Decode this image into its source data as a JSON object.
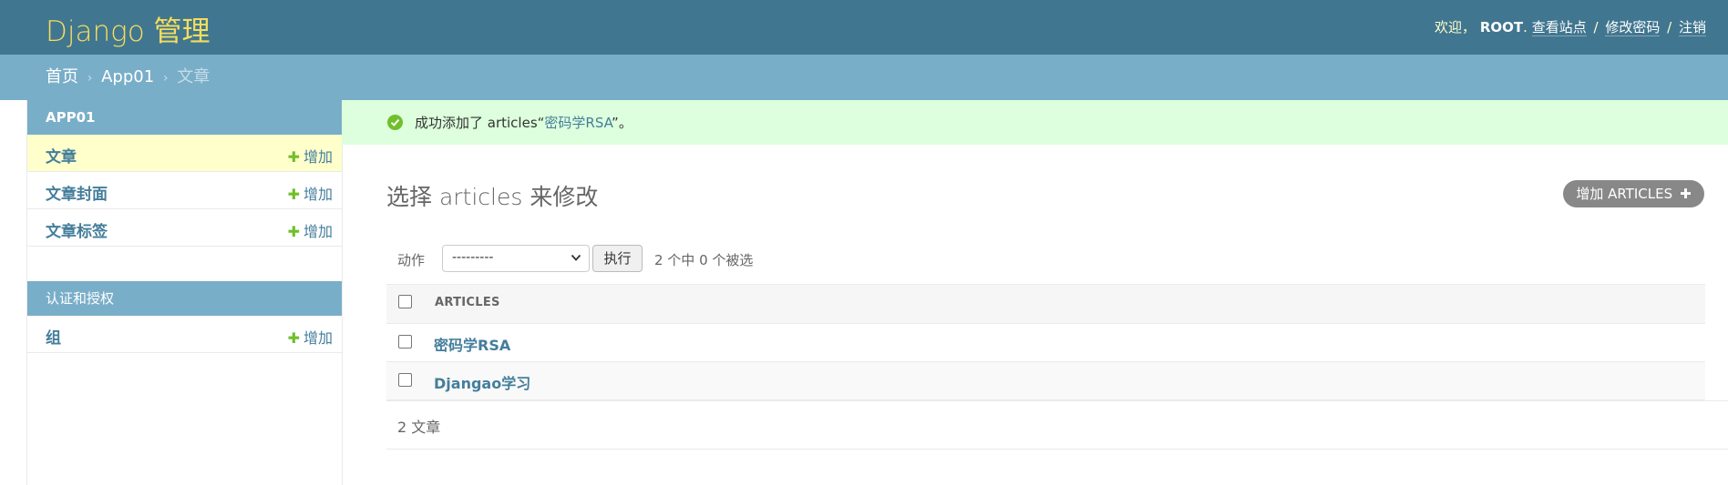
{
  "header": {
    "branding": "Django 管理",
    "welcome": "欢迎，",
    "username": "ROOT",
    "links": [
      {
        "label": "查看站点"
      },
      {
        "label": "修改密码"
      },
      {
        "label": "注销"
      }
    ]
  },
  "breadcrumbs": [
    {
      "label": "首页"
    },
    {
      "label": "App01"
    },
    {
      "label": "文章"
    }
  ],
  "sidebar": {
    "modules": [
      {
        "caption": "APP01",
        "items": [
          {
            "label": "文章",
            "add": "增加",
            "current": true
          },
          {
            "label": "文章封面",
            "add": "增加"
          },
          {
            "label": "文章标签",
            "add": "增加"
          }
        ]
      },
      {
        "caption": "认证和授权",
        "items": [
          {
            "label": "组",
            "add": "增加"
          }
        ]
      }
    ]
  },
  "message": {
    "prefix": "成功添加了 articles“",
    "link": "密码学RSA",
    "suffix": "”。"
  },
  "main": {
    "title": "选择 articles 来修改",
    "add_button": "增加 ARTICLES"
  },
  "actions": {
    "label": "动作",
    "select_value": "---------",
    "go_label": "执行",
    "counter": "2 个中 0 个被选"
  },
  "table": {
    "column_header": "ARTICLES",
    "rows": [
      {
        "title": "密码学RSA"
      },
      {
        "title": "Djangao学习"
      }
    ]
  },
  "paginator": "2 文章",
  "colors": {
    "header_bg": "#417690",
    "branding": "#f5dd5d",
    "breadcrumb_bg": "#79aec8",
    "link": "#447e9b",
    "success_bg": "#dfd",
    "add_green": "#70bf2b"
  }
}
